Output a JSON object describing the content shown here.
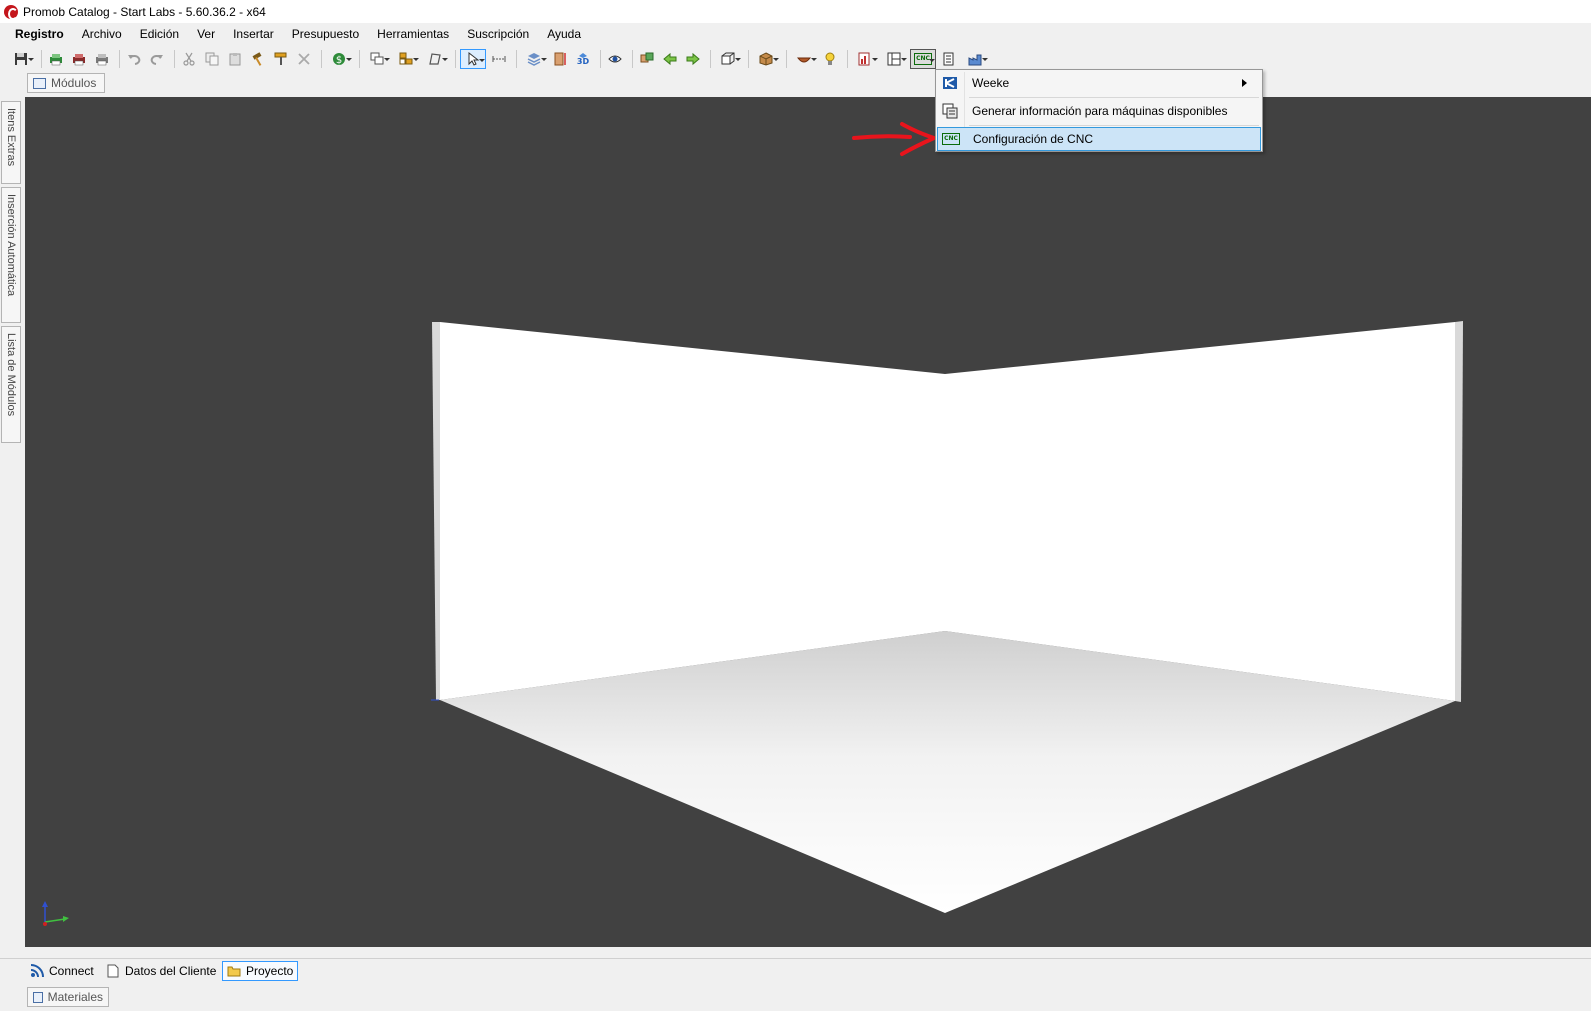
{
  "window": {
    "title": "Promob Catalog - Start Labs - 5.60.36.2 - x64",
    "logo_icon": "promob-logo-icon"
  },
  "menubar": {
    "items": [
      "Registro",
      "Archivo",
      "Edición",
      "Ver",
      "Insertar",
      "Presupuesto",
      "Herramientas",
      "Suscripción",
      "Ayuda"
    ]
  },
  "tabs_top": {
    "modulos": "Módulos"
  },
  "side_tabs": {
    "items": [
      "Itens Extras",
      "Inserción Automática",
      "Lista de Módulos"
    ]
  },
  "dropdown": {
    "items": [
      {
        "label": "Weeke",
        "icon": "weeke-icon",
        "has_submenu": true
      },
      {
        "label": "Generar información para máquinas disponibles",
        "icon": "machines-info-icon"
      },
      {
        "label": "Configuración de CNC",
        "icon": "cnc-config-icon",
        "highlighted": true
      }
    ]
  },
  "toolbar": {
    "cnc_label": "CNC"
  },
  "bottom_tabs": {
    "items": [
      {
        "label": "Connect",
        "icon": "rss-icon"
      },
      {
        "label": "Datos del Cliente",
        "icon": "document-icon"
      },
      {
        "label": "Proyecto",
        "icon": "folder-icon",
        "selected": true
      }
    ]
  },
  "bottom_tabs_2": {
    "materiales": "Materiales"
  },
  "colors": {
    "viewport_bg": "#414141",
    "highlight_bg": "#cce4f7",
    "highlight_border": "#3399dd",
    "annotation_arrow": "#e8141c"
  }
}
